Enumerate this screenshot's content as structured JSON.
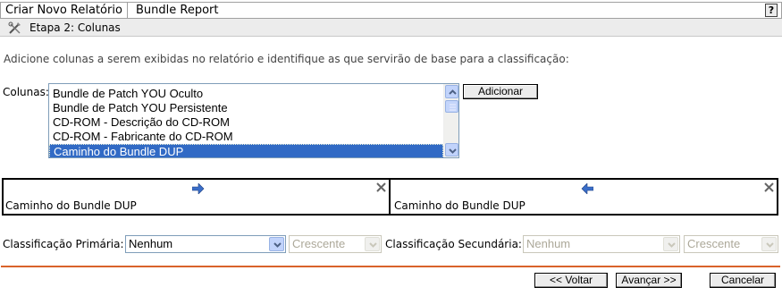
{
  "tabs": {
    "left_title": "Criar Novo Relatório",
    "right_title": "Bundle Report",
    "help_label": "?"
  },
  "step": {
    "icon": "wrench-pen-icon",
    "label": "Etapa 2: Colunas"
  },
  "instructions": "Adicione colunas a serem exibidas no relatório e identifique as que servirão de base para a classificação:",
  "columns": {
    "label": "Colunas:",
    "items": [
      "Bundle de Patch YOU Oculto",
      "Bundle de Patch YOU Persistente",
      "CD-ROM - Descrição do CD-ROM",
      "CD-ROM - Fabricante do CD-ROM",
      "Caminho do Bundle DUP"
    ],
    "selected_index": 4,
    "add_button": "Adicionar"
  },
  "sort_panel": {
    "left": {
      "label": "Caminho do Bundle DUP",
      "arrow_icon": "arrow-right-icon"
    },
    "right": {
      "label": "Caminho do Bundle DUP",
      "arrow_icon": "arrow-left-icon"
    }
  },
  "sorting": {
    "primary_label": "Classificação Primária:",
    "primary_value": "Nenhum",
    "primary_order": "Crescente",
    "secondary_label": "Classificação Secundária:",
    "secondary_value": "Nenhum",
    "secondary_order": "Crescente"
  },
  "buttons": {
    "back": "<< Voltar",
    "next": "Avançar >>",
    "cancel": "Cancelar"
  },
  "colors": {
    "accent_divider": "#d9632a",
    "selection": "#316ac5",
    "arrow_blue": "#3a6ec9"
  }
}
